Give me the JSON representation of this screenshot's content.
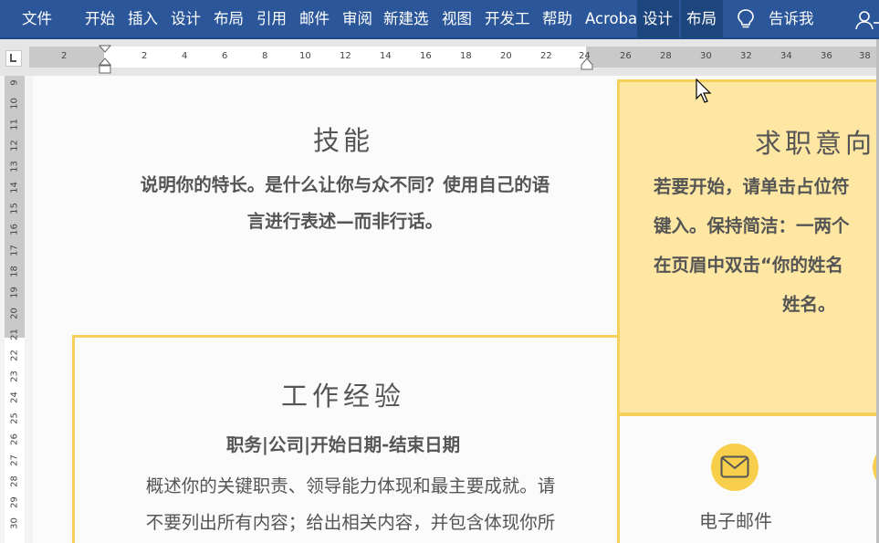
{
  "ribbon": {
    "tabs": [
      {
        "label": "文件",
        "id": "file"
      },
      {
        "label": "开始",
        "id": "home"
      },
      {
        "label": "插入",
        "id": "insert"
      },
      {
        "label": "设计",
        "id": "design"
      },
      {
        "label": "布局",
        "id": "layout"
      },
      {
        "label": "引用",
        "id": "references"
      },
      {
        "label": "邮件",
        "id": "mailings"
      },
      {
        "label": "审阅",
        "id": "review"
      },
      {
        "label": "新建选",
        "id": "new-tab"
      },
      {
        "label": "视图",
        "id": "view"
      },
      {
        "label": "开发工",
        "id": "developer"
      },
      {
        "label": "帮助",
        "id": "help"
      },
      {
        "label": "Acroba",
        "id": "acrobat"
      },
      {
        "label": "设计",
        "id": "table-design"
      },
      {
        "label": "布局",
        "id": "table-layout"
      }
    ],
    "tell_me": "告诉我",
    "icons": {
      "tell_me": "lightbulb-icon",
      "account": "user-icon"
    }
  },
  "ruler": {
    "h_labels": [
      "2",
      "2",
      "4",
      "6",
      "8",
      "10",
      "12",
      "14",
      "16",
      "18",
      "20",
      "22",
      "24",
      "26",
      "28",
      "30",
      "32",
      "34",
      "36",
      "38"
    ],
    "v_labels": [
      "9",
      "10",
      "11",
      "12",
      "13",
      "14",
      "15",
      "16",
      "17",
      "18",
      "19",
      "20",
      "21",
      "22",
      "23",
      "24",
      "25",
      "26",
      "27",
      "28",
      "29",
      "30"
    ]
  },
  "document": {
    "skills": {
      "heading": "技能",
      "body_line1": "说明你的特长。是什么让你与众不同？使用自己的语",
      "body_line2": "言进行表述—而非行话。"
    },
    "work": {
      "heading": "工作经验",
      "subtitle": "职务|公司|开始日期-结束日期",
      "body_line1": "概述你的关键职责、领导能力体现和最主要成就。请",
      "body_line2": "不要列出所有内容；给出相关内容，并包含体现你所"
    },
    "objective": {
      "heading": "求职意向",
      "line1": "若要开始，请单击占位符",
      "line2": "键入。保持简洁：一两个",
      "line3": "在页眉中双击“你的姓名",
      "line4": "姓名。"
    },
    "contact": {
      "email_label": "电子邮件",
      "email_icon": "envelope-icon"
    }
  },
  "colors": {
    "ribbon": "#2b579a",
    "accent_yellow": "#f5d15c",
    "objective_fill": "#fde7a2",
    "text": "#555555"
  }
}
